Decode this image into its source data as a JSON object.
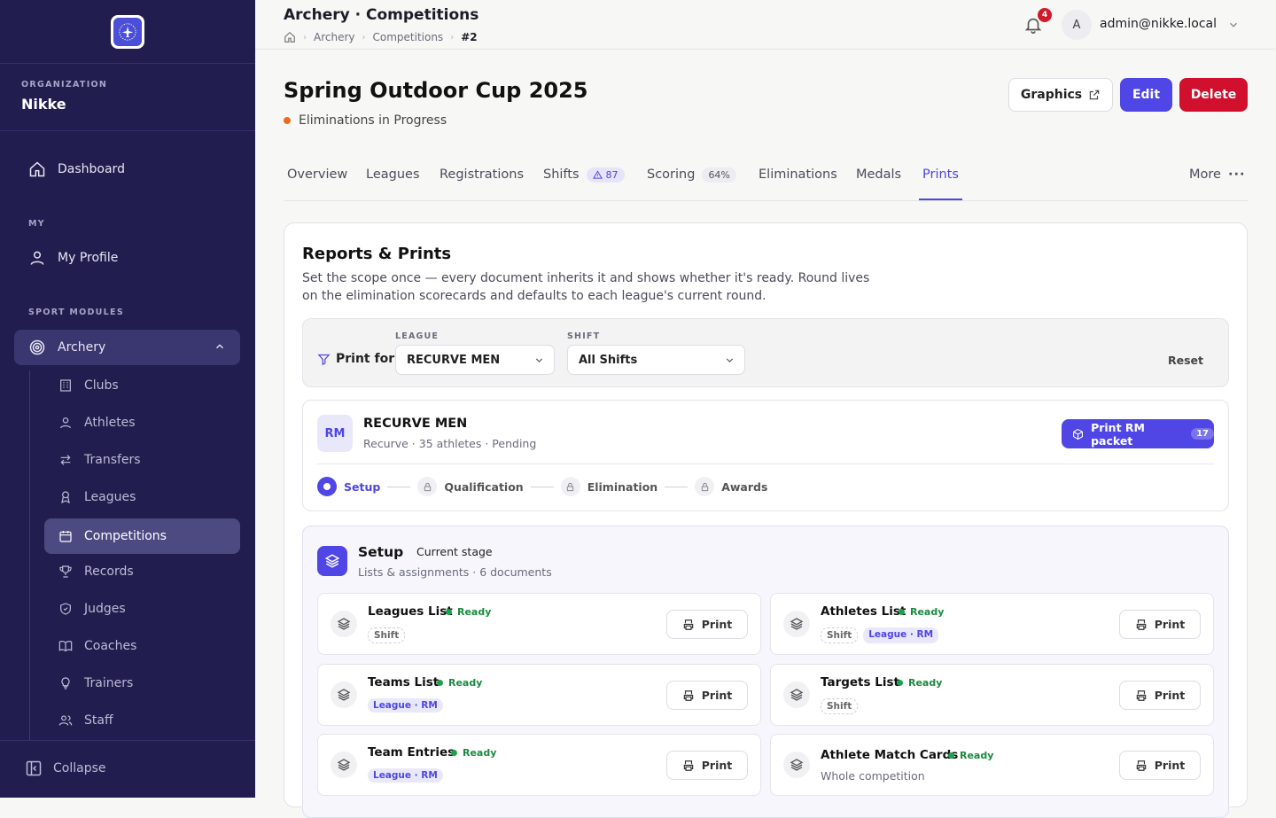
{
  "org": {
    "caption": "ORGANIZATION",
    "name": "Nikke"
  },
  "nav": {
    "dashboard": "Dashboard",
    "my_caption": "MY",
    "my_profile": "My Profile",
    "sport_caption": "SPORT MODULES",
    "archery": "Archery",
    "sub": [
      {
        "label": "Clubs",
        "icon": "building-icon"
      },
      {
        "label": "Athletes",
        "icon": "user-icon"
      },
      {
        "label": "Transfers",
        "icon": "arrows-icon"
      },
      {
        "label": "Leagues",
        "icon": "ribbon-icon"
      },
      {
        "label": "Competitions",
        "icon": "calendar-icon"
      },
      {
        "label": "Records",
        "icon": "trophy-icon"
      },
      {
        "label": "Judges",
        "icon": "shield-icon"
      },
      {
        "label": "Coaches",
        "icon": "book-icon"
      },
      {
        "label": "Trainers",
        "icon": "bulb-icon"
      },
      {
        "label": "Staff",
        "icon": "users-icon"
      }
    ],
    "collapse": "Collapse"
  },
  "header": {
    "title": "Archery · Competitions",
    "breadcrumbs": [
      "Archery",
      "Competitions",
      "#2"
    ],
    "notifications": "4",
    "avatar": "A",
    "user": "admin@nikke.local"
  },
  "competition": {
    "title": "Spring Outdoor Cup 2025",
    "status": "Eliminations in Progress",
    "status_color": "#f06a1d"
  },
  "actions": {
    "graphics": "Graphics",
    "edit": "Edit",
    "delete": "Delete"
  },
  "tabs": {
    "overview": "Overview",
    "leagues": "Leagues",
    "registrations": "Registrations",
    "shifts": "Shifts",
    "shifts_count": "87",
    "scoring": "Scoring",
    "scoring_pct": "64%",
    "eliminations": "Eliminations",
    "medals": "Medals",
    "prints": "Prints",
    "more": "More"
  },
  "reports": {
    "title": "Reports & Prints",
    "description": "Set the scope once — every document inherits it and shows whether it's ready. Round lives on the elimination scorecards and defaults to each league's current round."
  },
  "filter": {
    "print_for": "Print for",
    "league_caption": "LEAGUE",
    "league_value": "RECURVE MEN",
    "shift_caption": "SHIFT",
    "shift_value": "All Shifts",
    "reset": "Reset"
  },
  "league": {
    "code": "RM",
    "name": "RECURVE MEN",
    "meta": "Recurve · 35 athletes · Pending",
    "packet_label": "Print RM packet",
    "packet_count": "17",
    "steps": [
      "Setup",
      "Qualification",
      "Elimination",
      "Awards"
    ]
  },
  "stage": {
    "name": "Setup",
    "tag": "Current stage",
    "meta": "Lists & assignments · 6 documents"
  },
  "documents": [
    {
      "name": "Leagues List",
      "status": "Ready",
      "tag1": "Shift",
      "print": "Print"
    },
    {
      "name": "Athletes List",
      "status": "Ready",
      "tag1": "Shift",
      "tag2": "League · RM",
      "print": "Print"
    },
    {
      "name": "Teams List",
      "status": "Ready",
      "tag2": "League · RM",
      "print": "Print"
    },
    {
      "name": "Targets List",
      "status": "Ready",
      "tag1": "Shift",
      "print": "Print"
    },
    {
      "name": "Team Entries",
      "status": "Ready",
      "tag2": "League · RM",
      "print": "Print"
    },
    {
      "name": "Athlete Match Cards",
      "status": "Ready",
      "subtitle": "Whole competition",
      "print": "Print"
    }
  ],
  "colors": {
    "accent": "#4f46e5",
    "danger": "#d0102c",
    "sidebar": "#211d4e",
    "ready": "#1aa34a"
  }
}
